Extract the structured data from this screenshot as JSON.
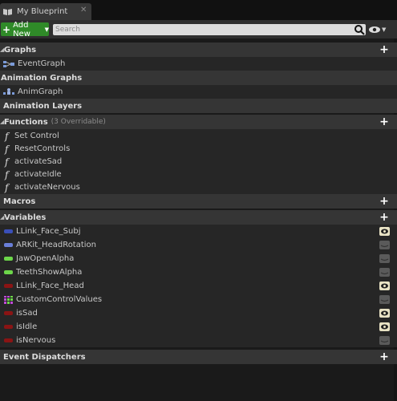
{
  "panel": {
    "tab_title": "My Blueprint",
    "tab_close": "✕"
  },
  "toolbar": {
    "add_new_label": "Add New",
    "search_placeholder": "Search"
  },
  "sections": {
    "graphs": {
      "label": "Graphs",
      "items": [
        "EventGraph"
      ]
    },
    "animation_graphs": {
      "label": "Animation Graphs",
      "items": [
        "AnimGraph"
      ]
    },
    "animation_layers": {
      "label": "Animation Layers"
    },
    "functions": {
      "label": "Functions",
      "note": "(3 Overridable)",
      "items": [
        "Set Control",
        "ResetControls",
        "activateSad",
        "activateIdle",
        "activateNervous"
      ]
    },
    "macros": {
      "label": "Macros"
    },
    "variables": {
      "label": "Variables",
      "items": [
        {
          "name": "LLink_Face_Subj",
          "color": "#3a4fb8",
          "visible": true
        },
        {
          "name": "ARKit_HeadRotation",
          "color": "#6a7fd8",
          "visible": false
        },
        {
          "name": "JawOpenAlpha",
          "color": "#6dd64a",
          "visible": false
        },
        {
          "name": "TeethShowAlpha",
          "color": "#6dd64a",
          "visible": false
        },
        {
          "name": "LLink_Face_Head",
          "color": "#8a1414",
          "visible": true
        },
        {
          "name": "CustomControlValues",
          "color": "grid",
          "visible": false
        },
        {
          "name": "isSad",
          "color": "#8a1414",
          "visible": true
        },
        {
          "name": "isIdle",
          "color": "#8a1414",
          "visible": true
        },
        {
          "name": "isNervous",
          "color": "#8a1414",
          "visible": false
        }
      ]
    },
    "event_dispatchers": {
      "label": "Event Dispatchers"
    }
  },
  "colors": {
    "accent_green": "#2f8a28",
    "bool_red": "#8a1414",
    "float_green": "#6dd64a",
    "struct_blue": "#3a4fb8"
  },
  "icons": {
    "add": "plus-icon",
    "visibility": "eye-icon",
    "function": "function-icon"
  }
}
